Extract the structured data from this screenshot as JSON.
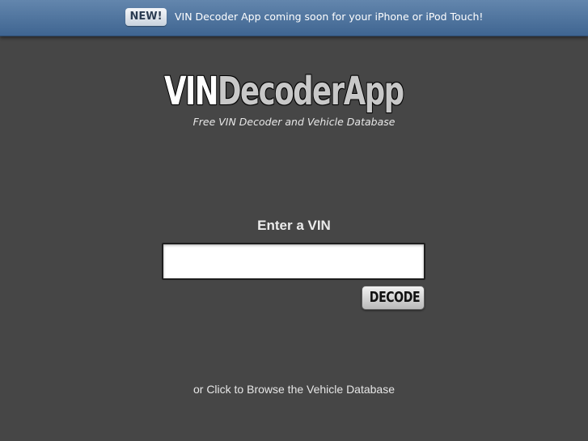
{
  "announcement": {
    "badge": "NEW!",
    "text": "VIN Decoder App coming soon for your iPhone or iPod Touch!"
  },
  "logo": {
    "part1": "VIN",
    "part2": "DecoderApp"
  },
  "tagline": "Free VIN Decoder and Vehicle Database",
  "vin_form": {
    "label": "Enter a VIN",
    "input_value": "",
    "decode_label": "DECODE"
  },
  "browse_link": "or Click to Browse the Vehicle Database"
}
